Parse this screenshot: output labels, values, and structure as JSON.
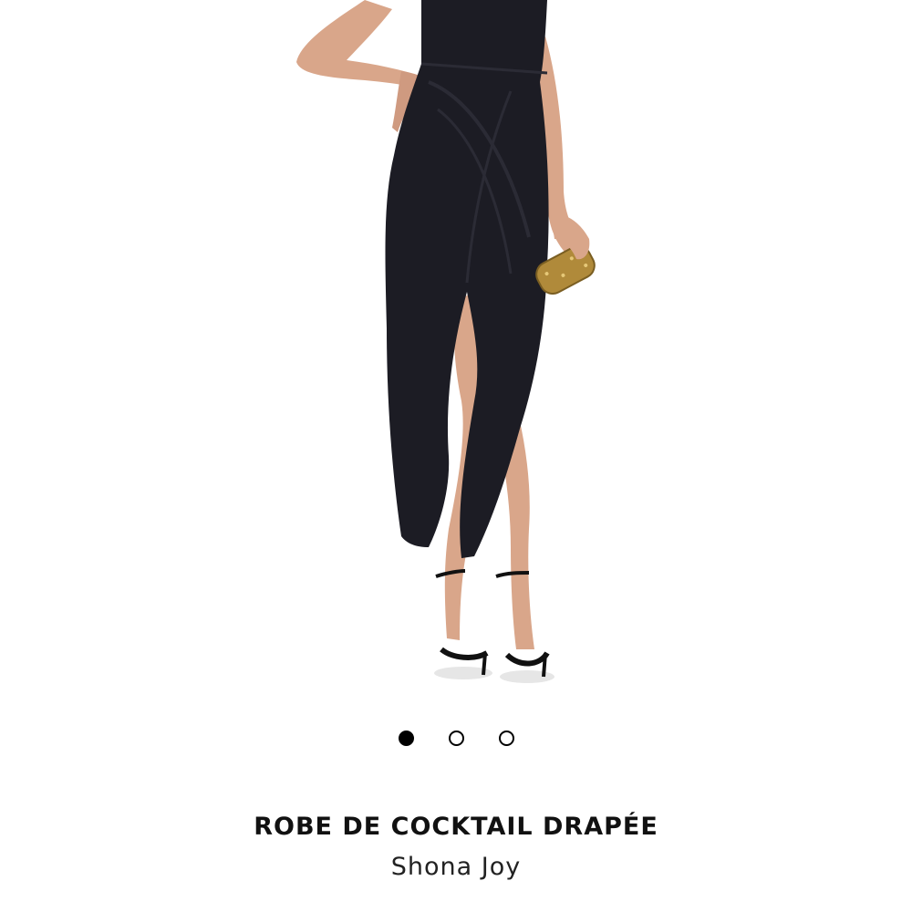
{
  "product": {
    "image": {
      "subject": "model-wearing-black-drape-dress",
      "colors": {
        "background": "#ffffff",
        "dress": "#1c1c24",
        "skin": "#d9a68a",
        "clutch": "#b08a3a",
        "shoes": "#111111"
      }
    },
    "carousel": {
      "total": 3,
      "active_index": 0,
      "colors": {
        "active": "#000000",
        "inactive_border": "#000000"
      }
    },
    "title": "ROBE DE COCKTAIL DRAPÉE",
    "brand": "Shona Joy"
  }
}
